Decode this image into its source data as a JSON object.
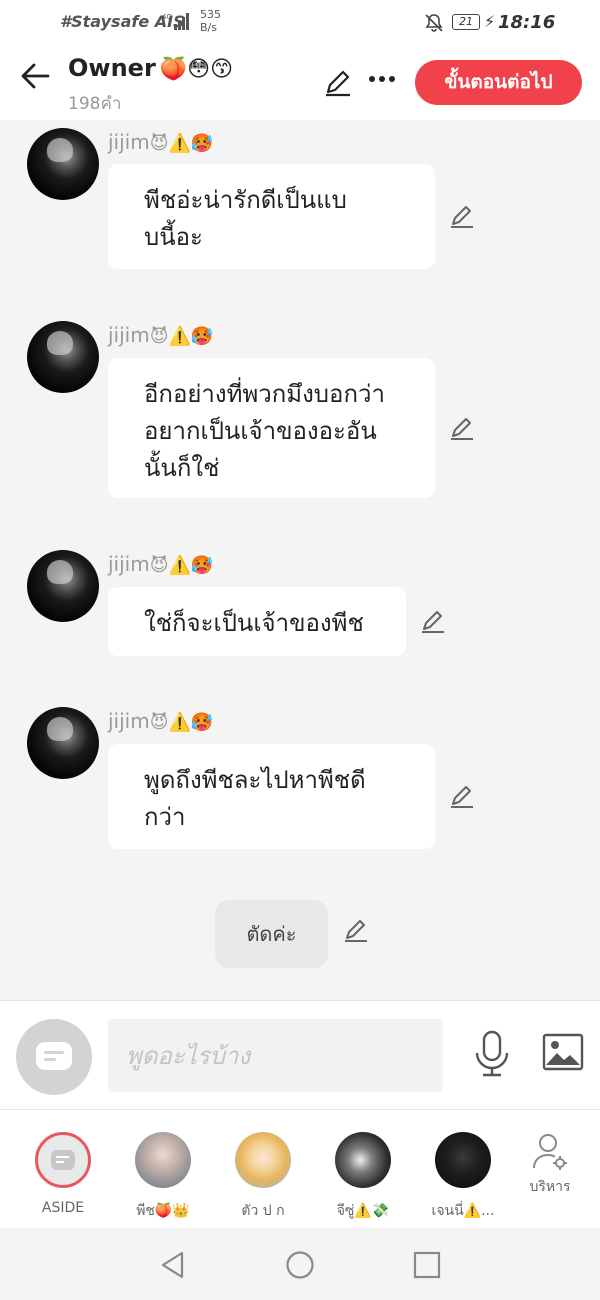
{
  "status_bar": {
    "carrier": "#Staysafe AIS",
    "network": "4G",
    "net_speed": "535",
    "net_speed_unit": "B/s",
    "battery": "21",
    "time": "18:16"
  },
  "header": {
    "title": "Owner",
    "title_emoji": "🍑😳😙",
    "member_count": "198คำ",
    "next_button": "ขั้นตอนต่อไป"
  },
  "messages": [
    {
      "user": "jijim",
      "badges": "😈⚠️🥵",
      "text_lines": [
        "พีชอ่ะน่ารักดีเป็นแบ",
        "บนี้อะ"
      ]
    },
    {
      "user": "jijim",
      "badges": "😈⚠️🥵",
      "text_lines": [
        "อีกอย่างที่พวกมึงบอกว่า",
        "อยากเป็นเจ้าของอะอัน",
        "นั้นก็ใช่"
      ]
    },
    {
      "user": "jijim",
      "badges": "😈⚠️🥵",
      "text_lines": [
        "ใช่ก็จะเป็นเจ้าของพีช"
      ]
    },
    {
      "user": "jijim",
      "badges": "😈⚠️🥵",
      "text_lines": [
        "พูดถึงพีชละไปหาพีชดี",
        "กว่า"
      ]
    }
  ],
  "narration": "ตัดค่ะ",
  "input": {
    "placeholder": "พูดอะไรบ้าง"
  },
  "rooms": [
    {
      "label": "ASIDE",
      "selected": true
    },
    {
      "label": "พีช🍑👑"
    },
    {
      "label": "ตัว ป ก"
    },
    {
      "label": "จีซู่⚠️💸"
    },
    {
      "label": "เจนนี่⚠️..."
    }
  ],
  "manage_label": "บริหาร",
  "colors": {
    "accent": "#f1414b",
    "background": "#f4f4f4",
    "bubble": "#ffffff",
    "muted_text": "#9a9a9a"
  },
  "icons": {
    "back": "arrow-left-icon",
    "edit": "pencil-icon",
    "more": "more-dots-icon",
    "mic": "microphone-icon",
    "gallery": "image-icon",
    "manage": "person-gear-icon"
  }
}
